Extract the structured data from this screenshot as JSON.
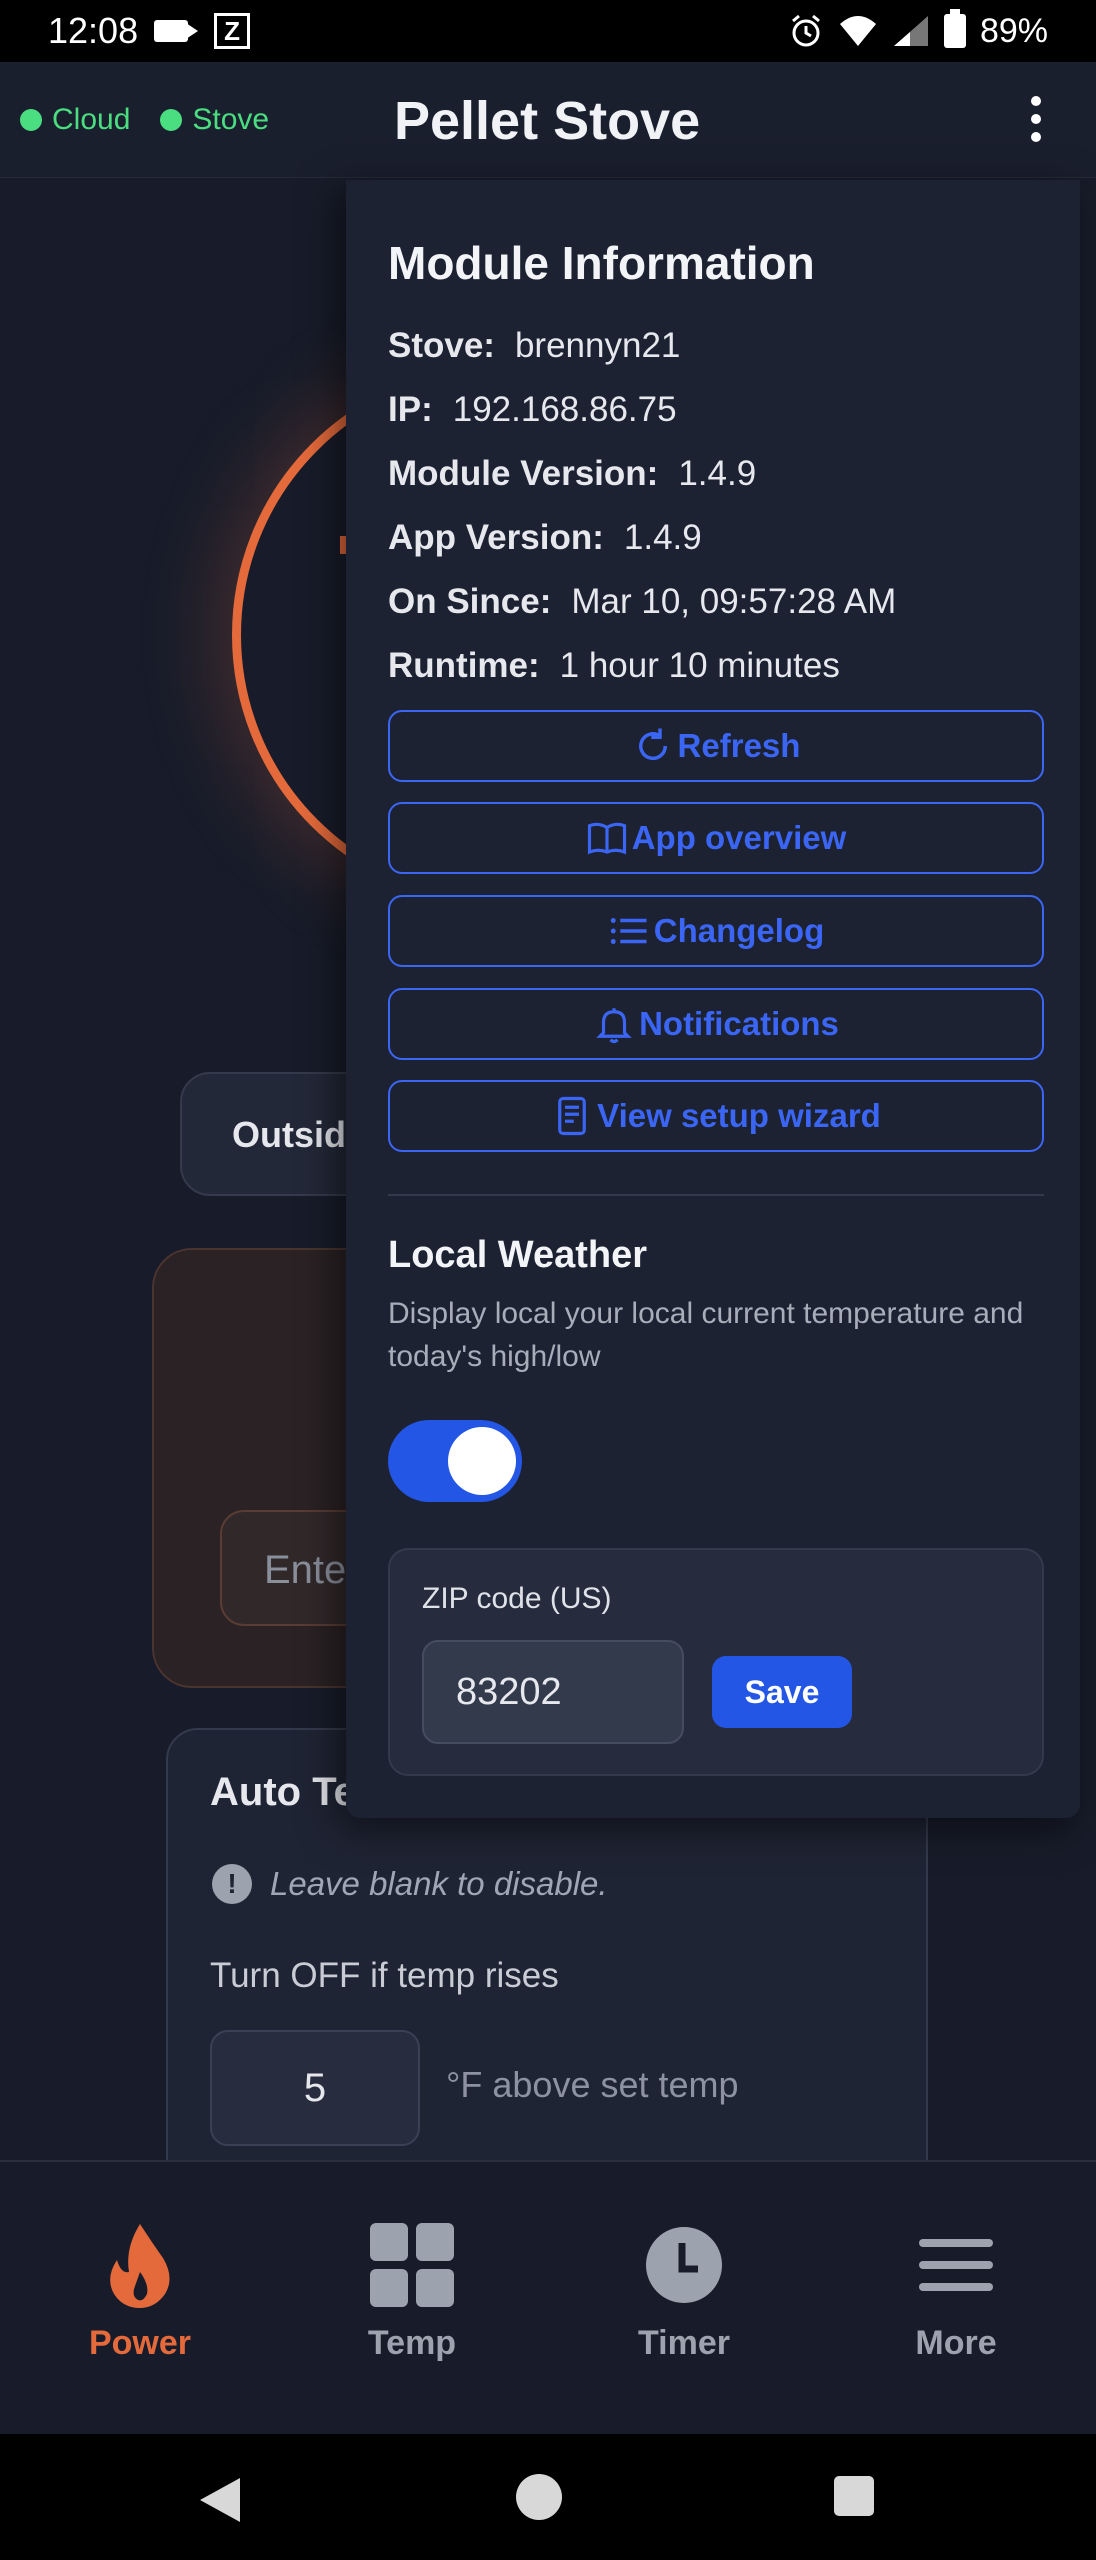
{
  "status_bar": {
    "time": "12:08",
    "battery": "89%"
  },
  "header": {
    "title": "Pellet Stove",
    "connections": [
      {
        "label": "Cloud",
        "color": "#4ade80"
      },
      {
        "label": "Stove",
        "color": "#4ade80"
      }
    ]
  },
  "background": {
    "outside_label": "Outsid",
    "enter_placeholder": "Ente",
    "auto_title": "Auto Te",
    "hint": "Leave blank to disable.",
    "rule_label": "Turn OFF if temp rises",
    "rule_value": "5",
    "rule_suffix": "°F above set temp"
  },
  "panel": {
    "title": "Module Information",
    "info": [
      {
        "key": "Stove:",
        "value": "brennyn21"
      },
      {
        "key": "IP:",
        "value": "192.168.86.75"
      },
      {
        "key": "Module Version:",
        "value": "1.4.9"
      },
      {
        "key": "App Version:",
        "value": "1.4.9"
      },
      {
        "key": "On Since:",
        "value": "Mar 10, 09:57:28 AM"
      },
      {
        "key": "Runtime:",
        "value": "1 hour 10 minutes"
      }
    ],
    "buttons": [
      {
        "label": "Refresh",
        "icon": "refresh-icon"
      },
      {
        "label": "App overview",
        "icon": "book-icon"
      },
      {
        "label": "Changelog",
        "icon": "list-icon"
      },
      {
        "label": "Notifications",
        "icon": "bell-icon"
      },
      {
        "label": "View setup wizard",
        "icon": "document-icon"
      }
    ],
    "weather": {
      "title": "Local Weather",
      "description": "Display local your local current temperature and today's high/low",
      "toggle_on": true,
      "zip_label": "ZIP code (US)",
      "zip_value": "83202",
      "save_label": "Save"
    }
  },
  "bottom_nav": {
    "items": [
      {
        "label": "Power",
        "icon": "flame-icon",
        "active": true
      },
      {
        "label": "Temp",
        "icon": "grid-icon",
        "active": false
      },
      {
        "label": "Timer",
        "icon": "clock-icon",
        "active": false
      },
      {
        "label": "More",
        "icon": "menu-icon",
        "active": false
      }
    ]
  },
  "colors": {
    "accent": "#2456e6",
    "active": "#e56a3b",
    "online": "#4ade80"
  }
}
